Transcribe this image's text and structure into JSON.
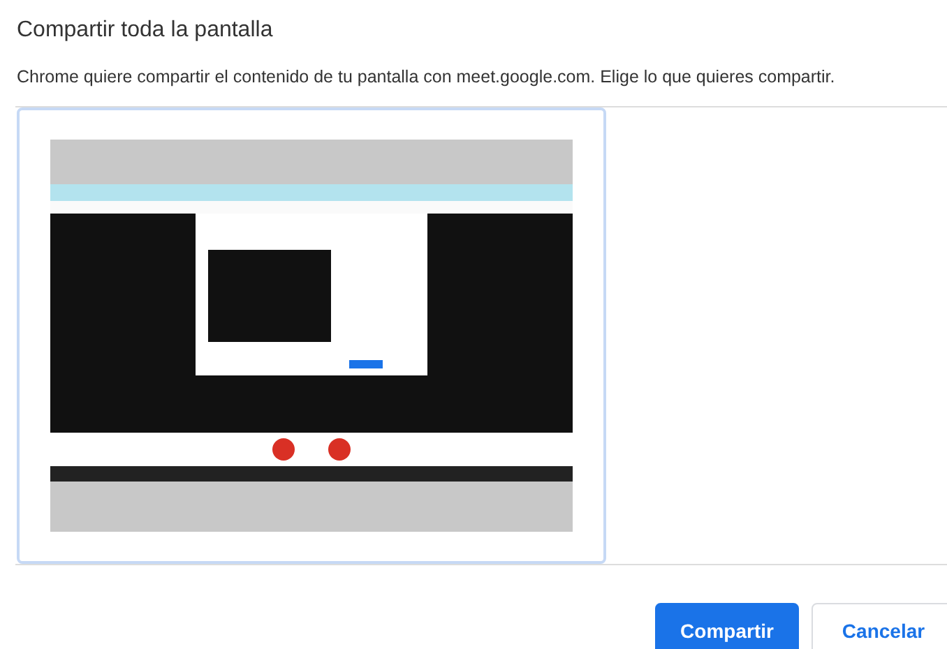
{
  "dialog": {
    "title": "Compartir toda la pantalla",
    "description": "Chrome quiere compartir el contenido de tu pantalla con meet.google.com. Elige lo que quieres compartir.",
    "sources": [
      {
        "kind": "picture",
        "selected": true
      }
    ],
    "buttons": [
      {
        "label": "Compartir",
        "kind": "primary"
      },
      {
        "label": "Cancelar",
        "kind": "secondary"
      }
    ]
  }
}
